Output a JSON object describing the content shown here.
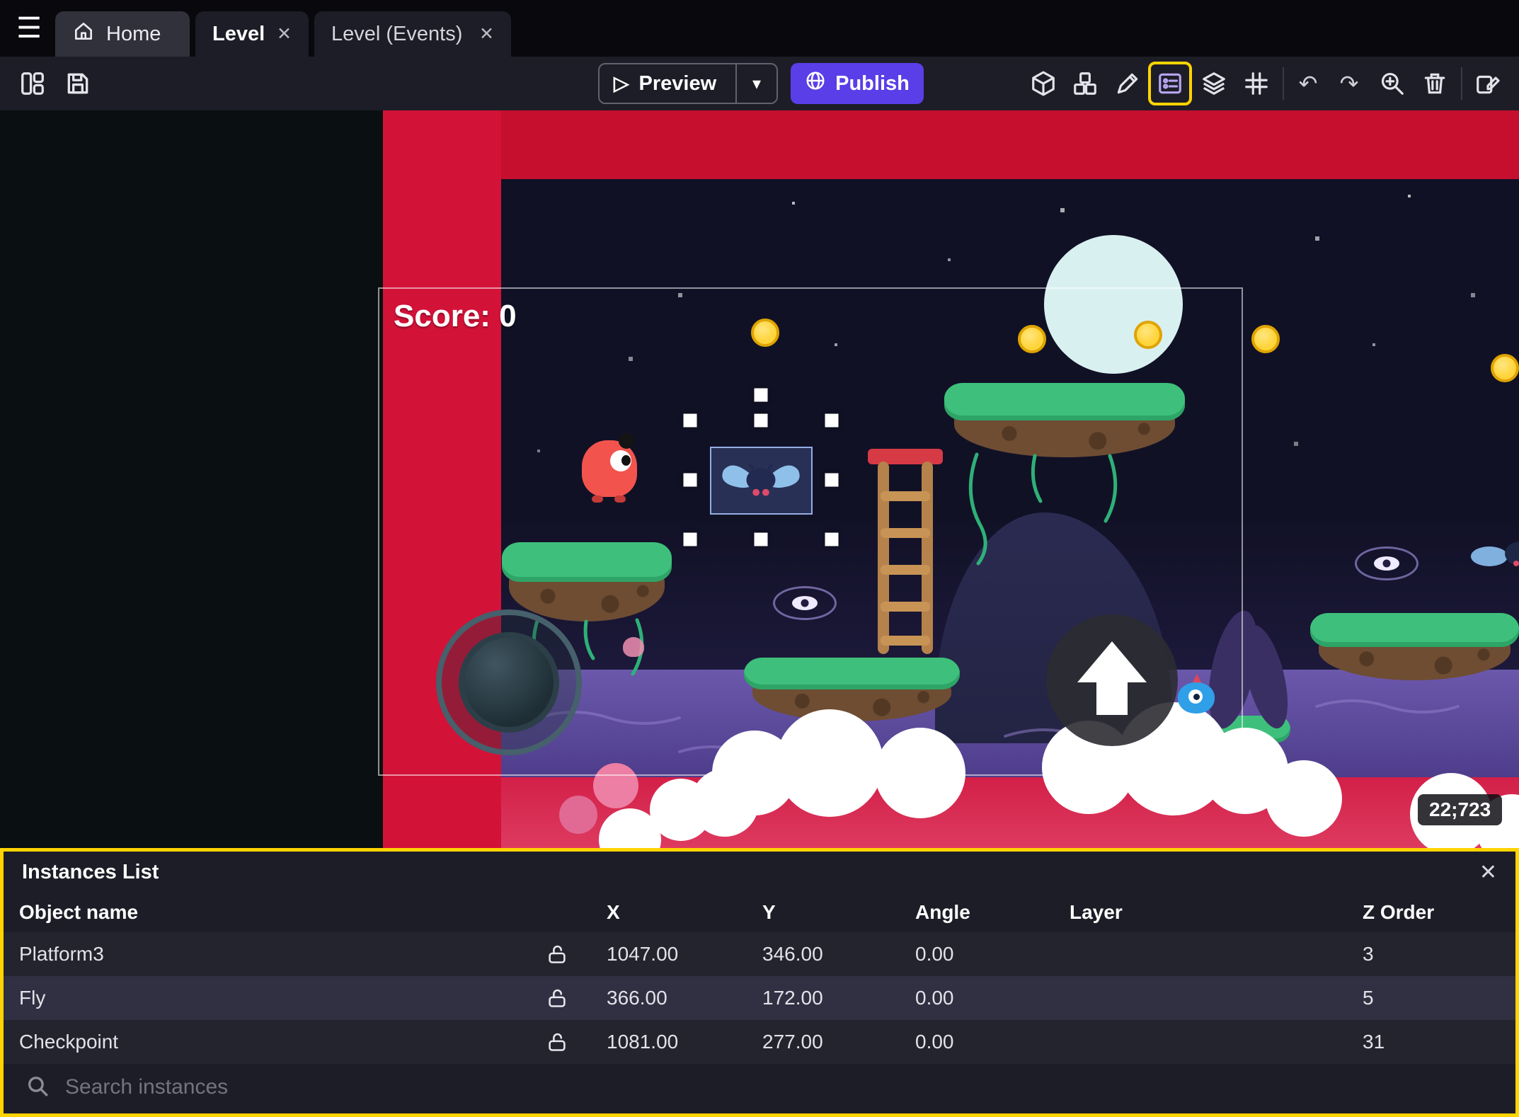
{
  "colors": {
    "accent_purple": "#5a3ee8",
    "highlight_yellow": "#ffd400",
    "selection_blue": "#95aee5",
    "red_band_top": "#c60f2f",
    "red_band_vertical": "#d31238",
    "pink_band_bottom": "#d9234e"
  },
  "icons": {
    "hamburger": "☰",
    "close": "✕",
    "caret_down": "▾",
    "play": "▷",
    "undo": "↶",
    "redo": "↷"
  },
  "tabbar": {
    "tabs": [
      {
        "label": "Home"
      },
      {
        "label": "Level"
      },
      {
        "label": "Level (Events)"
      }
    ]
  },
  "toolbar": {
    "preview_label": "Preview",
    "publish_label": "Publish"
  },
  "game": {
    "score_label": "Score: 0",
    "coordinates_badge": "22;723"
  },
  "instances_panel": {
    "title": "Instances List",
    "columns": [
      "Object name",
      "X",
      "Y",
      "Angle",
      "Layer",
      "Z Order"
    ],
    "rows": [
      {
        "name": "Platform3",
        "x": "1047.00",
        "y": "346.00",
        "angle": "0.00",
        "layer": "",
        "z": "3"
      },
      {
        "name": "Fly",
        "x": "366.00",
        "y": "172.00",
        "angle": "0.00",
        "layer": "",
        "z": "5"
      },
      {
        "name": "Checkpoint",
        "x": "1081.00",
        "y": "277.00",
        "angle": "0.00",
        "layer": "",
        "z": "31"
      }
    ],
    "search_placeholder": "Search instances"
  }
}
